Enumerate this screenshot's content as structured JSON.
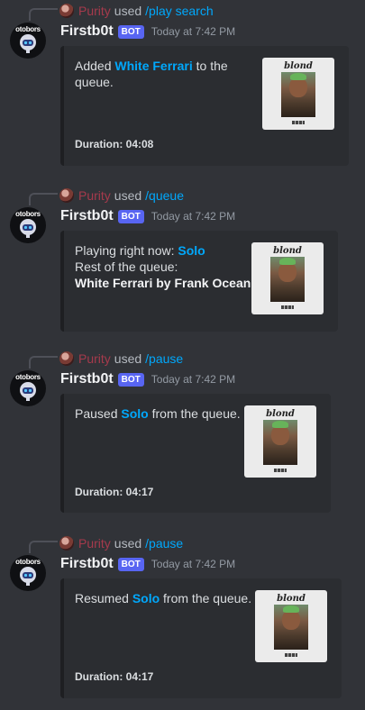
{
  "messages": [
    {
      "reply": {
        "user": "Purity",
        "used": "used",
        "command": "/play search"
      },
      "bot": {
        "avatar_text": "otobors",
        "name": "Firstb0t",
        "badge": "BOT",
        "time": "Today at 7:42 PM"
      },
      "embed": {
        "lines": [
          {
            "parts": [
              {
                "t": "Added "
              },
              {
                "t": "White Ferrari",
                "s": "hl"
              },
              {
                "t": " to the"
              }
            ]
          },
          {
            "parts": [
              {
                "t": "queue."
              }
            ]
          }
        ],
        "duration": "Duration: 04:08",
        "thumb": {
          "title": "blond"
        }
      }
    },
    {
      "reply": {
        "user": "Purity",
        "used": "used",
        "command": "/queue"
      },
      "bot": {
        "avatar_text": "otobors",
        "name": "Firstb0t",
        "badge": "BOT",
        "time": "Today at 7:42 PM"
      },
      "embed": {
        "lines": [
          {
            "parts": [
              {
                "t": "Playing right now: "
              },
              {
                "t": "Solo",
                "s": "hl"
              }
            ]
          },
          {
            "parts": [
              {
                "t": "Rest of the queue:"
              }
            ]
          },
          {
            "parts": [
              {
                "t": "White Ferrari by Frank Ocean",
                "s": "strong"
              }
            ]
          }
        ],
        "duration": "",
        "thumb": {
          "title": "blond"
        }
      }
    },
    {
      "reply": {
        "user": "Purity",
        "used": "used",
        "command": "/pause"
      },
      "bot": {
        "avatar_text": "otobors",
        "name": "Firstb0t",
        "badge": "BOT",
        "time": "Today at 7:42 PM"
      },
      "embed": {
        "lines": [
          {
            "parts": [
              {
                "t": "Paused "
              },
              {
                "t": "Solo",
                "s": "hl"
              },
              {
                "t": " from the queue."
              }
            ]
          }
        ],
        "duration": "Duration: 04:17",
        "thumb": {
          "title": "blond"
        }
      }
    },
    {
      "reply": {
        "user": "Purity",
        "used": "used",
        "command": "/pause"
      },
      "bot": {
        "avatar_text": "otobors",
        "name": "Firstb0t",
        "badge": "BOT",
        "time": "Today at 7:42 PM"
      },
      "embed": {
        "lines": [
          {
            "parts": [
              {
                "t": "Resumed "
              },
              {
                "t": "Solo",
                "s": "hl"
              },
              {
                "t": " from the queue."
              }
            ]
          }
        ],
        "duration": "Duration: 04:17",
        "thumb": {
          "title": "blond"
        }
      }
    }
  ],
  "colors": {
    "background": "#313338",
    "embed": "#2b2d31",
    "link": "#00a8fc",
    "badge": "#5865f2",
    "reply_user": "#a53a4c"
  },
  "icons": {
    "bot_avatar": "robot-icon",
    "reply_avatar": "user-avatar-icon",
    "thumbnail": "album-cover-image"
  }
}
